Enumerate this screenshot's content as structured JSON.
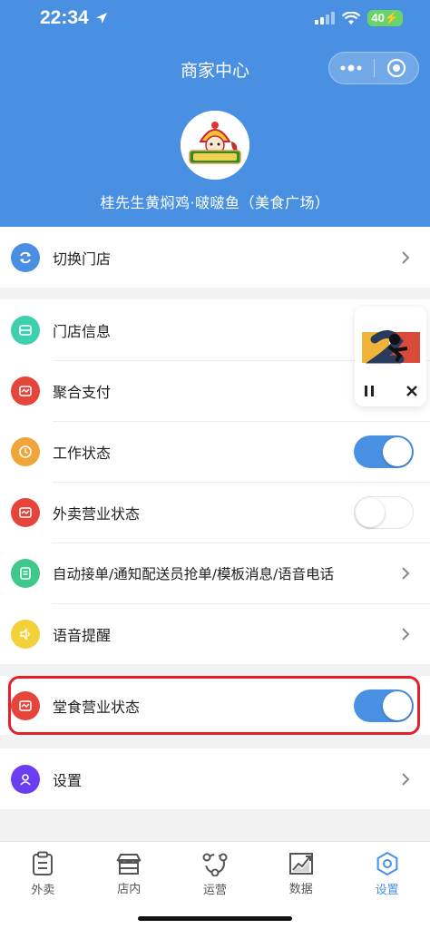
{
  "status_bar": {
    "time": "22:34",
    "battery": "40"
  },
  "header": {
    "title": "商家中心",
    "store_name": "桂先生黄焖鸡·啵啵鱼（美食广场）"
  },
  "rows": {
    "switch_store": "切换门店",
    "store_info": "门店信息",
    "aggregate_pay": "聚合支付",
    "work_status": "工作状态",
    "takeout_status": "外卖营业状态",
    "auto_accept": "自动接单/通知配送员抢单/模板消息/语音电话",
    "voice_reminder": "语音提醒",
    "dinein_status": "堂食营业状态",
    "settings": "设置"
  },
  "toggles": {
    "work_status": true,
    "takeout_status": false,
    "dinein_status": true
  },
  "icon_colors": {
    "switch_store": "#4a90e2",
    "store_info": "#3ecfae",
    "aggregate_pay": "#e5453b",
    "work_status": "#f0a53a",
    "takeout_status": "#e5453b",
    "auto_accept": "#3ec98a",
    "voice_reminder": "#f3d13a",
    "dinein_status": "#e5453b",
    "settings": "#6a3df0"
  },
  "tabs": [
    {
      "label": "外卖",
      "icon": "clipboard-icon"
    },
    {
      "label": "店内",
      "icon": "store-icon"
    },
    {
      "label": "运营",
      "icon": "network-icon"
    },
    {
      "label": "数据",
      "icon": "chart-icon"
    },
    {
      "label": "设置",
      "icon": "gear-icon",
      "active": true
    }
  ]
}
